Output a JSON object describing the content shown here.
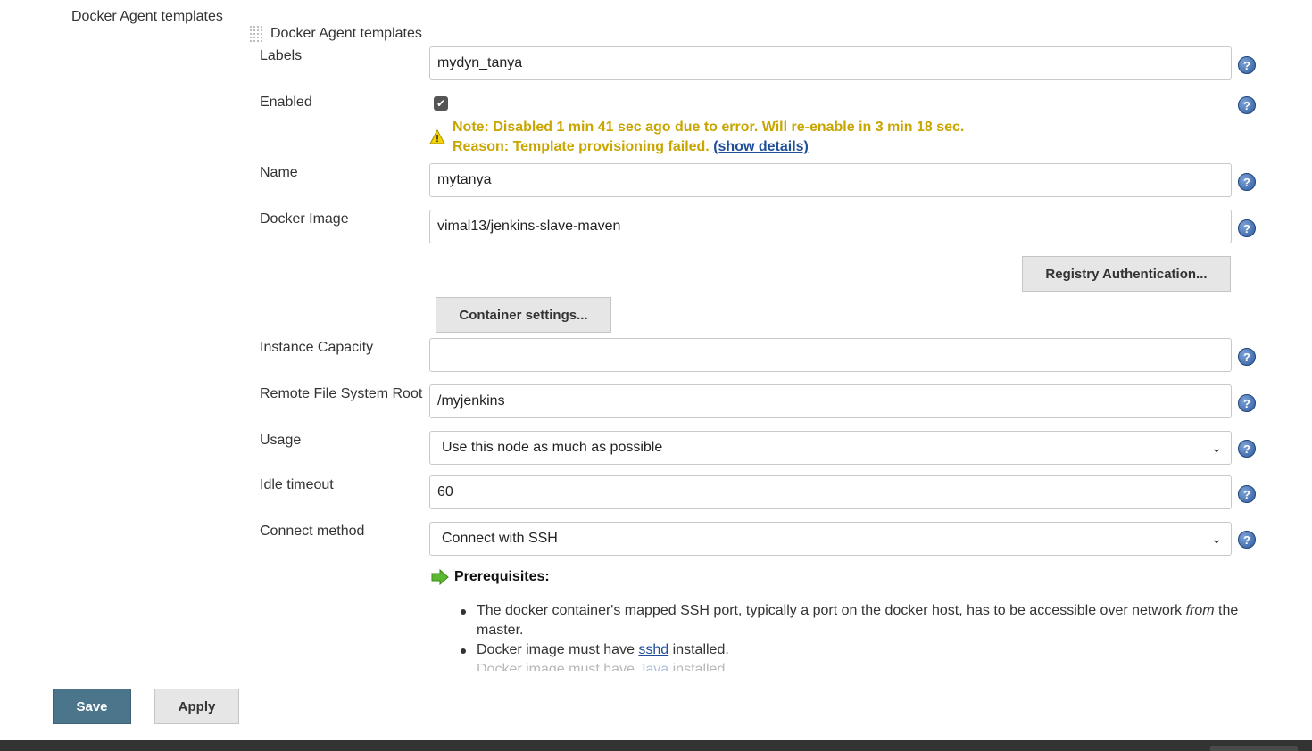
{
  "section": {
    "title": "Docker Agent templates",
    "subtitle": "Docker Agent templates"
  },
  "form": {
    "labels": {
      "label": "Labels",
      "value": "mydyn_tanya"
    },
    "enabled": {
      "label": "Enabled",
      "checked": true
    },
    "warning": {
      "line1": "Note: Disabled 1 min 41 sec ago due to error. Will re-enable in 3 min 18 sec.",
      "line2_prefix": "Reason: Template provisioning failed.",
      "link": "(show details)"
    },
    "name": {
      "label": "Name",
      "value": "mytanya"
    },
    "docker_image": {
      "label": "Docker Image",
      "value": "vimal13/jenkins-slave-maven"
    },
    "registry_auth_button": "Registry Authentication...",
    "container_settings_button": "Container settings...",
    "instance_capacity": {
      "label": "Instance Capacity",
      "value": ""
    },
    "remote_fs_root": {
      "label": "Remote File System Root",
      "value": "/myjenkins"
    },
    "usage": {
      "label": "Usage",
      "selected": "Use this node as much as possible"
    },
    "idle_timeout": {
      "label": "Idle timeout",
      "value": "60"
    },
    "connect_method": {
      "label": "Connect method",
      "selected": "Connect with SSH"
    }
  },
  "prerequisites": {
    "title": "Prerequisites:",
    "item1_prefix": "The docker container's mapped SSH port, typically a port on the docker host, has to be accessible over network ",
    "item1_em": "from",
    "item1_suffix": " the master.",
    "item2_prefix": "Docker image must have ",
    "item2_link": "sshd",
    "item2_suffix": " installed.",
    "item3_prefix": "Docker image must have ",
    "item3_link": "Java",
    "item3_suffix": " installed."
  },
  "buttons": {
    "save": "Save",
    "apply": "Apply"
  },
  "help_icon_glyph": "?",
  "colors": {
    "warning": "#c9a500",
    "save_button": "#4b758b",
    "link": "#1f4e99",
    "help_icon": "#2d5a9e"
  }
}
